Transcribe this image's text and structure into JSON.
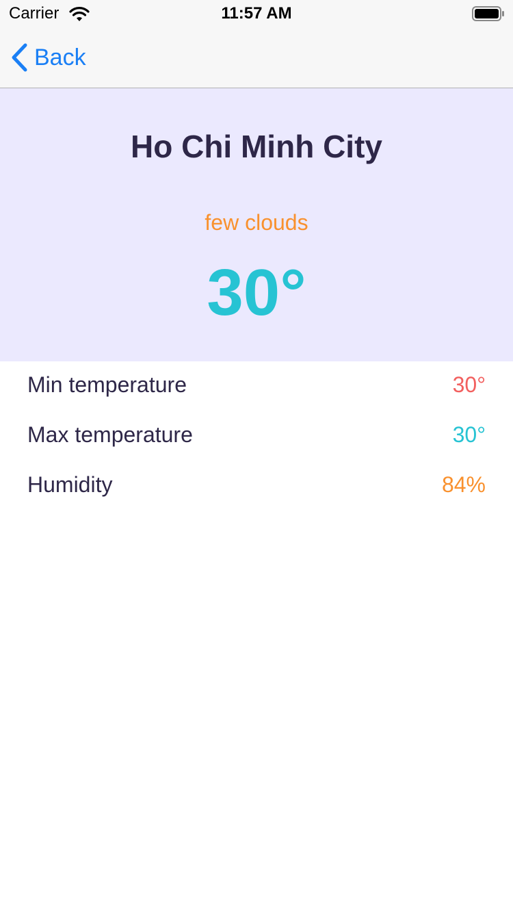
{
  "status_bar": {
    "carrier": "Carrier",
    "time": "11:57 AM",
    "wifi_icon": "wifi-icon",
    "battery_icon": "battery-icon"
  },
  "nav": {
    "back_label": "Back",
    "back_icon": "chevron-left-icon",
    "accent_color": "#1a7ff5"
  },
  "weather": {
    "city": "Ho Chi Minh City",
    "description": "few clouds",
    "temperature": "30°",
    "background_color": "#ebe9fe",
    "description_color": "#f9912e",
    "temperature_color": "#27c3d3"
  },
  "details": [
    {
      "label": "Min temperature",
      "value": "30°",
      "color": "#f2605f"
    },
    {
      "label": "Max temperature",
      "value": "30°",
      "color": "#27c3d3"
    },
    {
      "label": "Humidity",
      "value": "84%",
      "color": "#f9912e"
    }
  ]
}
